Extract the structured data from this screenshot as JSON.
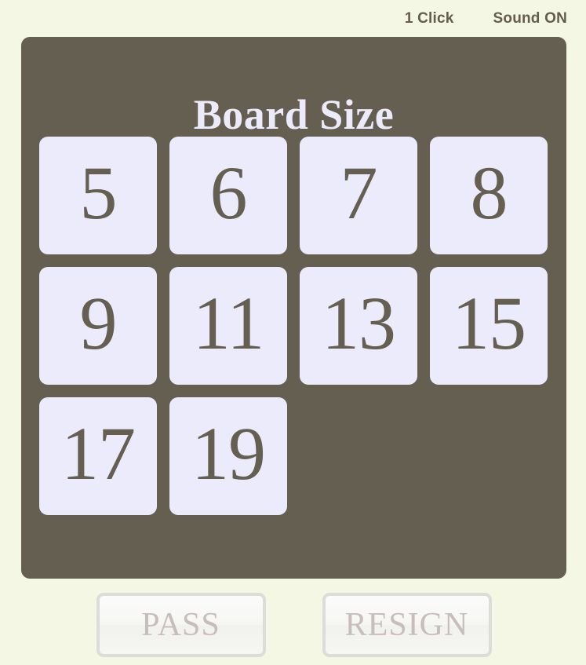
{
  "statusbar": {
    "click_mode": "1 Click",
    "sound_mode": "Sound ON"
  },
  "panel": {
    "title": "Board Size",
    "tiles": [
      {
        "label": "5"
      },
      {
        "label": "6"
      },
      {
        "label": "7"
      },
      {
        "label": "8"
      },
      {
        "label": "9"
      },
      {
        "label": "11"
      },
      {
        "label": "13"
      },
      {
        "label": "15"
      },
      {
        "label": "17"
      },
      {
        "label": "19"
      }
    ]
  },
  "actions": {
    "pass_label": "PASS",
    "resign_label": "RESIGN"
  },
  "colors": {
    "background": "#f4f7e4",
    "panel": "#645f51",
    "tile": "#ecebfb",
    "tile_text": "#645f51",
    "title_text": "#ecebfb",
    "status_text": "#635d50",
    "button_border": "#dddcd7",
    "button_text": "#c8bdbd"
  }
}
